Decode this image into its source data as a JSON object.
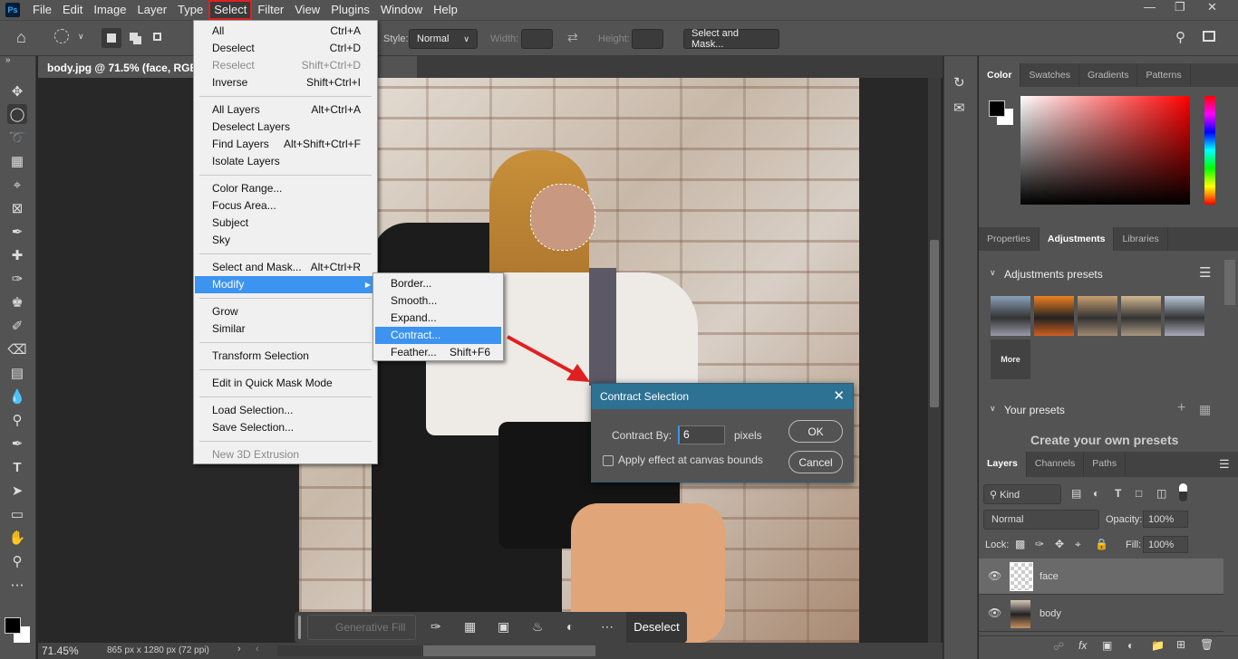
{
  "app": {
    "logo": "Ps",
    "menus": [
      "File",
      "Edit",
      "Image",
      "Layer",
      "Type",
      "Select",
      "Filter",
      "View",
      "Plugins",
      "Window",
      "Help"
    ],
    "active_menu": "Select",
    "window_controls": [
      "minimize",
      "restore",
      "close"
    ]
  },
  "options": {
    "style_label": "Style:",
    "style_value": "Normal",
    "width_label": "Width:",
    "height_label": "Height:",
    "select_mask": "Select and Mask..."
  },
  "document": {
    "tab_title": "body.jpg @ 71.5% (face, RGB/8",
    "tab_suffix": "#) *",
    "zoom": "71.45%",
    "info": "865 px x 1280 px (72 ppi)"
  },
  "select_menu": [
    {
      "label": "All",
      "shortcut": "Ctrl+A"
    },
    {
      "label": "Deselect",
      "shortcut": "Ctrl+D"
    },
    {
      "label": "Reselect",
      "shortcut": "Shift+Ctrl+D",
      "disabled": true
    },
    {
      "label": "Inverse",
      "shortcut": "Shift+Ctrl+I"
    },
    {
      "label": "All Layers",
      "shortcut": "Alt+Ctrl+A"
    },
    {
      "label": "Deselect Layers",
      "shortcut": ""
    },
    {
      "label": "Find Layers",
      "shortcut": "Alt+Shift+Ctrl+F"
    },
    {
      "label": "Isolate Layers",
      "shortcut": ""
    },
    {
      "label": "Color Range...",
      "shortcut": ""
    },
    {
      "label": "Focus Area...",
      "shortcut": ""
    },
    {
      "label": "Subject",
      "shortcut": ""
    },
    {
      "label": "Sky",
      "shortcut": ""
    },
    {
      "label": "Select and Mask...",
      "shortcut": "Alt+Ctrl+R"
    },
    {
      "label": "Modify",
      "shortcut": "",
      "highlighted": true,
      "submenu": true
    },
    {
      "label": "Grow",
      "shortcut": ""
    },
    {
      "label": "Similar",
      "shortcut": ""
    },
    {
      "label": "Transform Selection",
      "shortcut": ""
    },
    {
      "label": "Edit in Quick Mask Mode",
      "shortcut": ""
    },
    {
      "label": "Load Selection...",
      "shortcut": ""
    },
    {
      "label": "Save Selection...",
      "shortcut": ""
    },
    {
      "label": "New 3D Extrusion",
      "shortcut": "",
      "disabled": true
    }
  ],
  "modify_submenu": [
    {
      "label": "Border...",
      "shortcut": ""
    },
    {
      "label": "Smooth...",
      "shortcut": ""
    },
    {
      "label": "Expand...",
      "shortcut": ""
    },
    {
      "label": "Contract...",
      "shortcut": "",
      "highlighted": true
    },
    {
      "label": "Feather...",
      "shortcut": "Shift+F6"
    }
  ],
  "dialog": {
    "title": "Contract Selection",
    "contract_label": "Contract By:",
    "contract_value": "6",
    "unit": "pixels",
    "checkbox_label": "Apply effect at canvas bounds",
    "checkbox_checked": false,
    "ok": "OK",
    "cancel": "Cancel"
  },
  "contextual_bar": {
    "generative_fill": "Generative Fill",
    "deselect": "Deselect"
  },
  "color_panel": {
    "tabs": [
      "Color",
      "Swatches",
      "Gradients",
      "Patterns"
    ],
    "active": "Color",
    "foreground": "#000000",
    "background": "#ffffff",
    "hue_color": "#ff0000"
  },
  "adjust_panel": {
    "tabs": [
      "Properties",
      "Adjustments",
      "Libraries"
    ],
    "active": "Adjustments",
    "presets_header": "Adjustments presets",
    "more": "More",
    "your_presets": "Your presets",
    "create_text": "Create your own presets"
  },
  "layers_panel": {
    "tabs": [
      "Layers",
      "Channels",
      "Paths"
    ],
    "active": "Layers",
    "kind": "Kind",
    "blend": "Normal",
    "opacity_label": "Opacity:",
    "opacity": "100%",
    "lock_label": "Lock:",
    "fill_label": "Fill:",
    "fill": "100%",
    "layers": [
      {
        "name": "face",
        "selected": true
      },
      {
        "name": "body",
        "selected": false
      }
    ]
  },
  "colors": {
    "accent": "#3c93f0",
    "dialog_title": "#2d7193",
    "annotation": "#e02020"
  }
}
